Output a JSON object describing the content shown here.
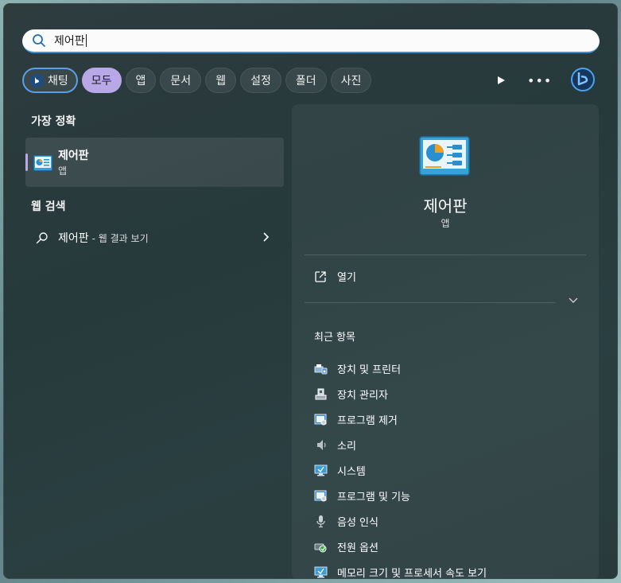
{
  "search": {
    "query": "제어판"
  },
  "filters": {
    "chat": "채팅",
    "items": [
      "모두",
      "앱",
      "문서",
      "웹",
      "설정",
      "폴더",
      "사진"
    ]
  },
  "best_match": {
    "title": "가장 정확",
    "name": "제어판",
    "type": "앱"
  },
  "web_search": {
    "title": "웹 검색",
    "query": "제어판",
    "suffix": "- 웹 결과 보기"
  },
  "detail": {
    "name": "제어판",
    "type": "앱",
    "open_label": "열기",
    "recent_title": "최근 항목",
    "recent_items": [
      {
        "label": "장치 및 프린터",
        "icon": "printer-icon"
      },
      {
        "label": "장치 관리자",
        "icon": "device-manager-icon"
      },
      {
        "label": "프로그램 제거",
        "icon": "programs-icon"
      },
      {
        "label": "소리",
        "icon": "speaker-icon"
      },
      {
        "label": "시스템",
        "icon": "monitor-icon"
      },
      {
        "label": "프로그램 및 기능",
        "icon": "programs-icon"
      },
      {
        "label": "음성 인식",
        "icon": "microphone-icon"
      },
      {
        "label": "전원 옵션",
        "icon": "power-icon"
      },
      {
        "label": "메모리 크기 및 프로세서 속도 보기",
        "icon": "monitor-icon"
      }
    ]
  },
  "colors": {
    "accent": "#b9a8e8",
    "search_underline": "#3a8fd8",
    "bing": "#1b4d82"
  }
}
